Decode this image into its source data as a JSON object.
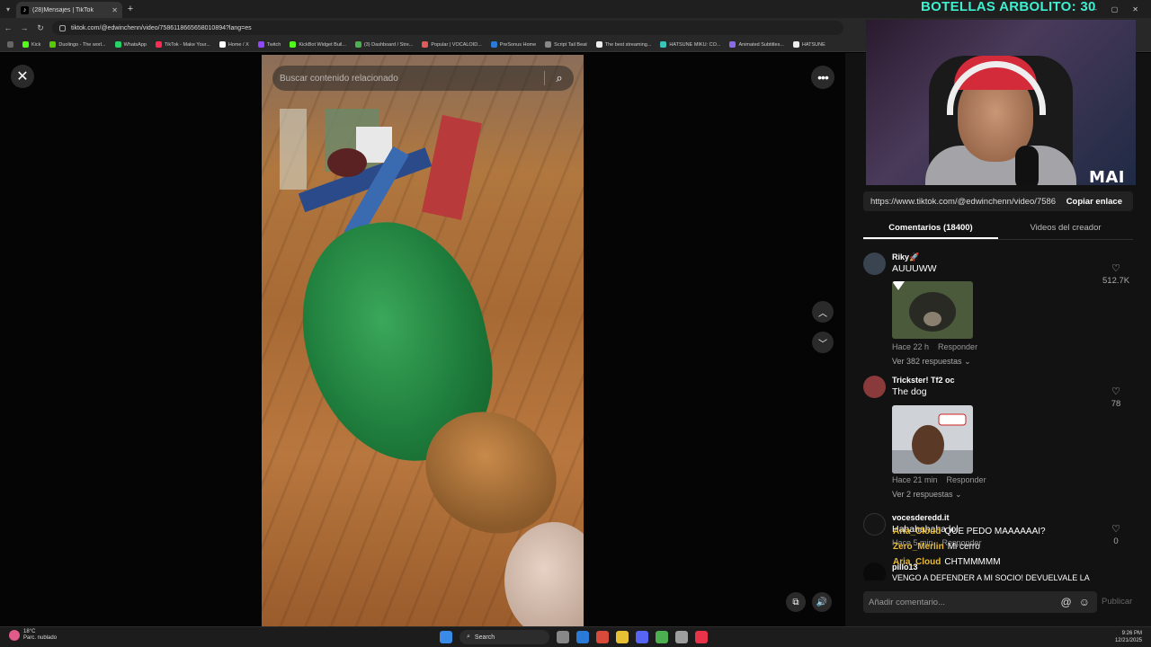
{
  "browser": {
    "tab_title": "(28)Mensajes | TikTok",
    "url": "tiktok.com/@edwinchenn/video/7586118665658010894?lang=es",
    "bookmarks": [
      "Kick",
      "Duolingo - The worl...",
      "WhatsApp",
      "TikTok - Make Your...",
      "Home / X",
      "Twitch",
      "KickBot Widget Buil...",
      "(3) Dashboard / Stre...",
      "Popular | VOCALOID...",
      "PreSonus Home",
      "Script Tail Beat",
      "The best streaming...",
      "HATSUNE MIKU: CO...",
      "Animated Subtitles...",
      "HATSUNE"
    ]
  },
  "overlay": {
    "title": "BOTELLAS ARBOLITO: 30",
    "cam_tag": "MAI"
  },
  "video": {
    "search_placeholder": "Buscar contenido relacionado"
  },
  "panel": {
    "link": "https://www.tiktok.com/@edwinchenn/video/7586...",
    "copy_label": "Copiar enlace",
    "tabs": [
      "Comentarios (18400)",
      "Videos del creador"
    ],
    "comments": [
      {
        "user": "Riky🚀",
        "text": "AUUUWW",
        "time": "Hace 22 h",
        "reply": "Responder",
        "replies": "Ver 382 respuestas",
        "likes": "512.7K"
      },
      {
        "user": "Trickster! Tf2 oc",
        "text": "The dog",
        "time": "Hace 21 min",
        "reply": "Responder",
        "replies": "Ver 2 respuestas",
        "likes": "78"
      },
      {
        "user": "vocesderedd.it",
        "text": "Hahahahaha lol",
        "time": "Hace 5 min",
        "reply": "Responder",
        "replies": "",
        "likes": "0"
      },
      {
        "user": "pillo13",
        "text": "VENGO A DEFENDER A MI SOCIO! DEVUELVALE LA",
        "time": "",
        "reply": "",
        "replies": "",
        "likes": ""
      }
    ],
    "input_placeholder": "Añadir comentario...",
    "publish": "Publicar"
  },
  "chat": [
    {
      "name": "Aria_Cloud",
      "msg": "QUE PEDO MAAAAAAI?"
    },
    {
      "name": "Zero_Merlin",
      "msg": "Mi cerro"
    },
    {
      "name": "Aria_Cloud",
      "msg": "CHTMMMMM"
    }
  ],
  "taskbar": {
    "temp": "18°C",
    "weather": "Parc. nublado",
    "search": "Search",
    "time": "9:26 PM",
    "date": "12/21/2025"
  }
}
